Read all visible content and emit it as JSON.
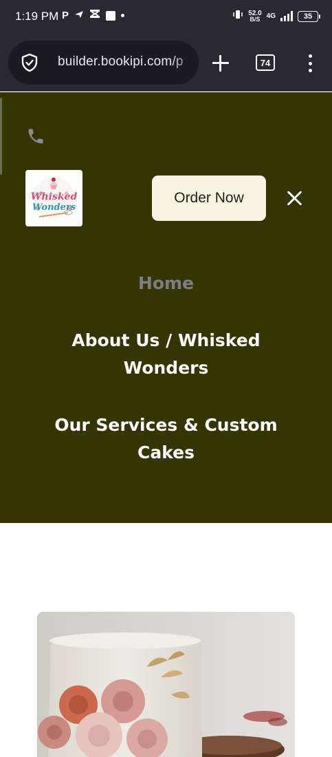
{
  "status_bar": {
    "time": "1:19 PM",
    "left_icons": [
      "p-icon",
      "send-icon",
      "crossed-box-icon",
      "square-icon",
      "dot-icon"
    ],
    "net_speed_value": "52.0",
    "net_speed_unit": "B/S",
    "network_type": "4G",
    "battery": "35"
  },
  "browser": {
    "url": "builder.bookipi.com/p",
    "tab_count": "74",
    "icons": {
      "security": "shield-check-icon",
      "new_tab": "plus-icon",
      "menu": "kebab-menu-icon"
    }
  },
  "site_menu": {
    "background_color": "#333504",
    "phone_icon": "phone-icon",
    "logo": {
      "line1": "Whisked",
      "line2": "Wonders"
    },
    "order_button": "Order Now",
    "close_icon": "close-icon",
    "nav": {
      "home": "Home",
      "about_line1": "About Us / Whisked",
      "about_line2": "Wonders",
      "services_line1": "Our Services & Custom",
      "services_line2": "Cakes"
    }
  },
  "content": {
    "hero_image": "cake-with-roses-image"
  }
}
